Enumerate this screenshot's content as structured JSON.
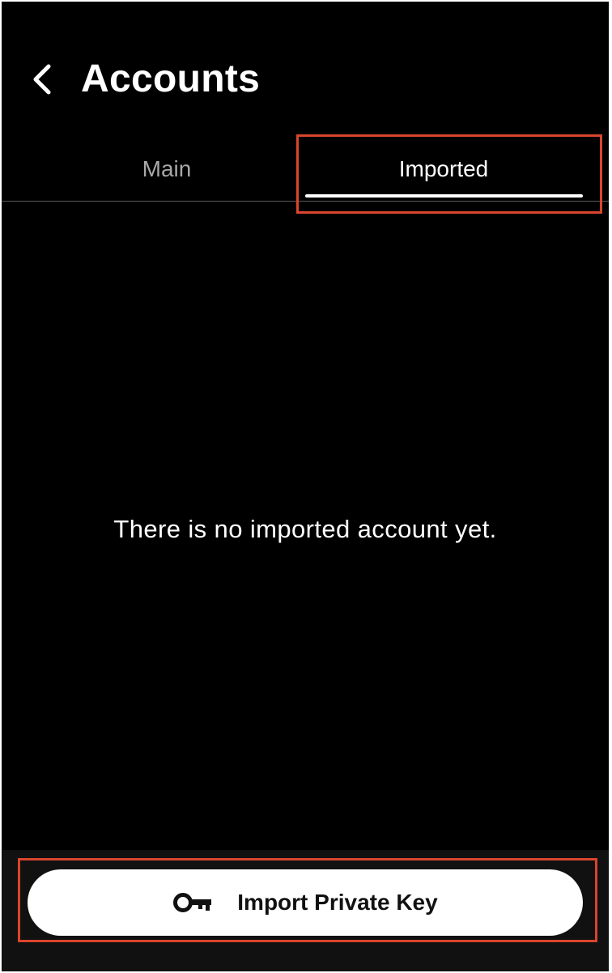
{
  "header": {
    "title": "Accounts",
    "back_icon": "chevron-left-icon"
  },
  "tabs": [
    {
      "label": "Main",
      "active": false
    },
    {
      "label": "Imported",
      "active": true
    }
  ],
  "content": {
    "empty_message": "There is no imported account yet."
  },
  "footer": {
    "import_button_label": "Import Private Key",
    "import_button_icon": "key-icon"
  },
  "colors": {
    "background": "#000000",
    "footer_background": "#111111",
    "text_primary": "#ffffff",
    "text_inactive": "#a8a8a8",
    "button_background": "#ffffff",
    "highlight_outline": "#d9452d"
  }
}
